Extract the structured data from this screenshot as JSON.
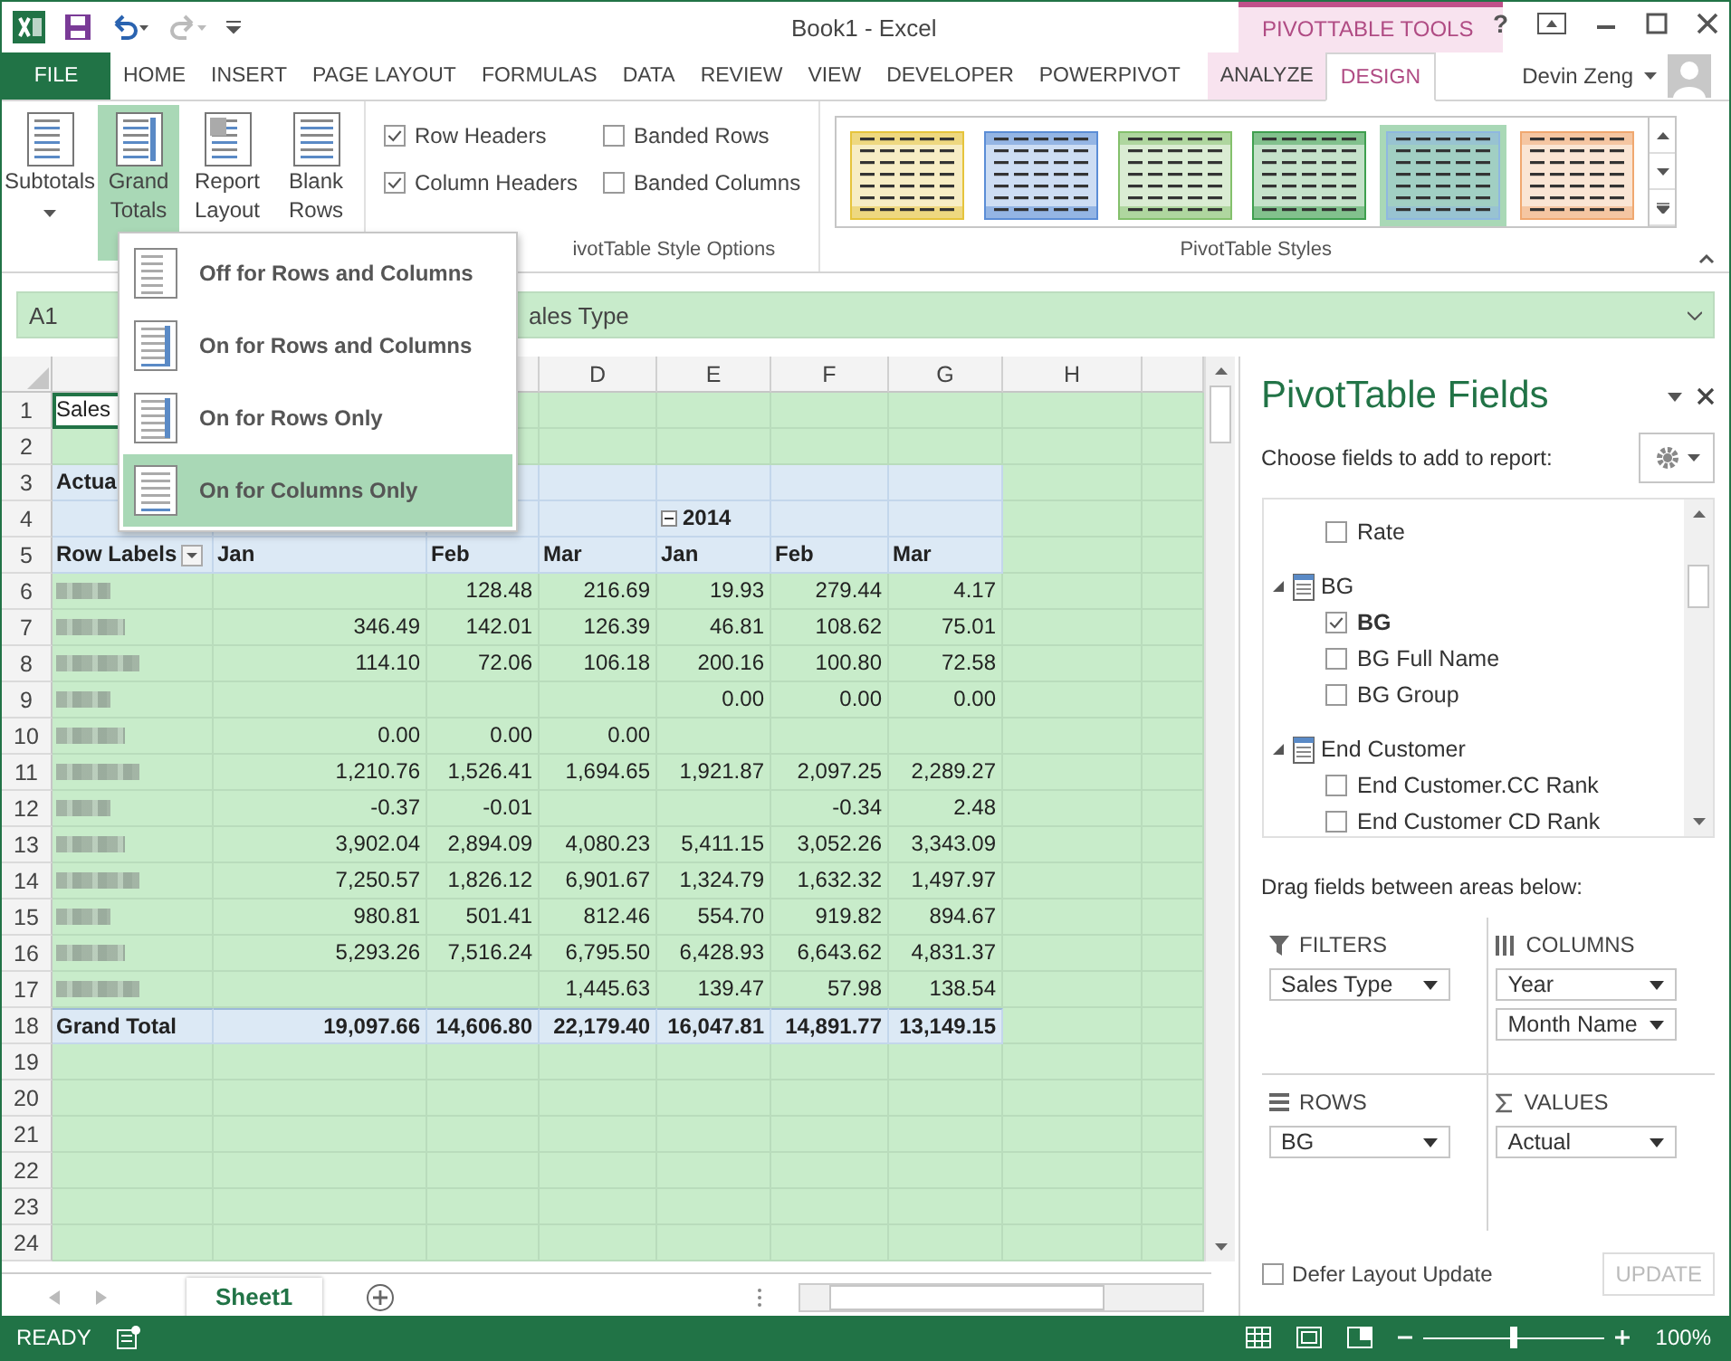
{
  "window": {
    "title": "Book1 - Excel",
    "context_tab": "PIVOTTABLE TOOLS",
    "help": "?"
  },
  "tabs": [
    {
      "label": "FILE",
      "kind": "file",
      "selected": false
    },
    {
      "label": "HOME",
      "kind": "tab",
      "selected": false
    },
    {
      "label": "INSERT",
      "kind": "tab",
      "selected": false
    },
    {
      "label": "PAGE LAYOUT",
      "kind": "tab",
      "selected": false
    },
    {
      "label": "FORMULAS",
      "kind": "tab",
      "selected": false
    },
    {
      "label": "DATA",
      "kind": "tab",
      "selected": false
    },
    {
      "label": "REVIEW",
      "kind": "tab",
      "selected": false
    },
    {
      "label": "VIEW",
      "kind": "tab",
      "selected": false
    },
    {
      "label": "DEVELOPER",
      "kind": "tab",
      "selected": false
    },
    {
      "label": "POWERPIVOT",
      "kind": "tab",
      "selected": false
    },
    {
      "label": "ANALYZE",
      "kind": "context",
      "selected": false
    },
    {
      "label": "DESIGN",
      "kind": "context",
      "selected": true
    }
  ],
  "user": {
    "name": "Devin Zeng"
  },
  "ribbon": {
    "layout_buttons": [
      {
        "lines": [
          "Subtotals"
        ],
        "selected": false
      },
      {
        "lines": [
          "Grand",
          "Totals"
        ],
        "selected": true
      },
      {
        "lines": [
          "Report",
          "Layout"
        ],
        "selected": false
      },
      {
        "lines": [
          "Blank",
          "Rows"
        ],
        "selected": false
      }
    ],
    "style_options": [
      {
        "label": "Row Headers",
        "checked": true
      },
      {
        "label": "Banded Rows",
        "checked": false
      },
      {
        "label": "Column Headers",
        "checked": true
      },
      {
        "label": "Banded Columns",
        "checked": false
      }
    ],
    "style_options_label": "ivotTable Style Options",
    "styles": [
      {
        "color": "#e6c43c",
        "selected": false
      },
      {
        "color": "#5b8dd6",
        "selected": false
      },
      {
        "color": "#84c06c",
        "selected": false
      },
      {
        "color": "#3f9f4f",
        "selected": false
      },
      {
        "color": "#8fb8e0",
        "selected": true
      },
      {
        "color": "#f0a870",
        "selected": false
      }
    ],
    "styles_label": "PivotTable Styles"
  },
  "grand_totals_menu": [
    {
      "label": "Off for Rows and Columns",
      "selected": false
    },
    {
      "label": "On for Rows and Columns",
      "selected": false
    },
    {
      "label": "On for Rows Only",
      "selected": false
    },
    {
      "label": "On for Columns Only",
      "selected": true
    }
  ],
  "formula_bar": {
    "name_box": "A1",
    "value": "ales Type"
  },
  "sheet": {
    "column_headers": [
      "D",
      "E",
      "F",
      "G",
      "H"
    ],
    "rows": [
      {
        "number": "1",
        "kind": "plain",
        "active_cell": true,
        "cells": [
          "Sales"
        ]
      },
      {
        "number": "2",
        "kind": "plain"
      },
      {
        "number": "3",
        "kind": "header",
        "cells": [
          "Actua"
        ]
      },
      {
        "number": "4",
        "kind": "header",
        "cells": [
          null,
          null,
          null,
          null,
          {
            "text": "2014",
            "expanded": true
          }
        ]
      },
      {
        "number": "5",
        "kind": "header",
        "cells": [
          {
            "text": "Row Labels",
            "filter": true
          },
          "Jan",
          "Feb",
          "Mar",
          "Jan",
          "Feb",
          "Mar"
        ]
      },
      {
        "number": "6",
        "kind": "data",
        "cells": [
          null,
          null,
          "128.48",
          "216.69",
          "19.93",
          "279.44",
          "4.17"
        ]
      },
      {
        "number": "7",
        "kind": "data",
        "cells": [
          null,
          "346.49",
          "142.01",
          "126.39",
          "46.81",
          "108.62",
          "75.01"
        ]
      },
      {
        "number": "8",
        "kind": "data",
        "cells": [
          null,
          "114.10",
          "72.06",
          "106.18",
          "200.16",
          "100.80",
          "72.58"
        ]
      },
      {
        "number": "9",
        "kind": "data",
        "cells": [
          null,
          null,
          null,
          null,
          "0.00",
          "0.00",
          "0.00"
        ]
      },
      {
        "number": "10",
        "kind": "data",
        "cells": [
          null,
          "0.00",
          "0.00",
          "0.00"
        ]
      },
      {
        "number": "11",
        "kind": "data",
        "cells": [
          null,
          "1,210.76",
          "1,526.41",
          "1,694.65",
          "1,921.87",
          "2,097.25",
          "2,289.27"
        ]
      },
      {
        "number": "12",
        "kind": "data",
        "cells": [
          null,
          "-0.37",
          "-0.01",
          null,
          null,
          "-0.34",
          "2.48"
        ]
      },
      {
        "number": "13",
        "kind": "data",
        "cells": [
          null,
          "3,902.04",
          "2,894.09",
          "4,080.23",
          "5,411.15",
          "3,052.26",
          "3,343.09"
        ]
      },
      {
        "number": "14",
        "kind": "data",
        "cells": [
          null,
          "7,250.57",
          "1,826.12",
          "6,901.67",
          "1,324.79",
          "1,632.32",
          "1,497.97"
        ]
      },
      {
        "number": "15",
        "kind": "data",
        "cells": [
          null,
          "980.81",
          "501.41",
          "812.46",
          "554.70",
          "919.82",
          "894.67"
        ]
      },
      {
        "number": "16",
        "kind": "data",
        "cells": [
          null,
          "5,293.26",
          "7,516.24",
          "6,795.50",
          "6,428.93",
          "6,643.62",
          "4,831.37"
        ]
      },
      {
        "number": "17",
        "kind": "data",
        "cells": [
          null,
          null,
          null,
          "1,445.63",
          "139.47",
          "57.98",
          "138.54"
        ]
      },
      {
        "number": "18",
        "kind": "total",
        "cells": [
          "Grand Total",
          "19,097.66",
          "14,606.80",
          "22,179.40",
          "16,047.81",
          "14,891.77",
          "13,149.15"
        ]
      },
      {
        "number": "19",
        "kind": "plain"
      },
      {
        "number": "20",
        "kind": "plain"
      },
      {
        "number": "21",
        "kind": "plain"
      },
      {
        "number": "22",
        "kind": "plain"
      },
      {
        "number": "23",
        "kind": "plain"
      },
      {
        "number": "24",
        "kind": "plain"
      }
    ],
    "sheet_tabs": [
      {
        "label": "Sheet1",
        "selected": true
      }
    ]
  },
  "field_pane": {
    "title": "PivotTable Fields",
    "prompt": "Choose fields to add to report:",
    "fields": [
      {
        "label": "Rate",
        "kind": "field",
        "checked": false
      },
      {
        "label": "BG",
        "kind": "table",
        "expanded": true,
        "children": [
          {
            "label": "BG",
            "kind": "field",
            "checked": true
          },
          {
            "label": "BG Full Name",
            "kind": "field",
            "checked": false
          },
          {
            "label": "BG Group",
            "kind": "field",
            "checked": false
          }
        ]
      },
      {
        "label": "End Customer",
        "kind": "table",
        "expanded": true,
        "children": [
          {
            "label": "End Customer.CC Rank",
            "kind": "field",
            "checked": false
          },
          {
            "label": "End Customer CD Rank",
            "kind": "field",
            "checked": false
          }
        ]
      }
    ],
    "drag_hint": "Drag fields between areas below:",
    "areas": [
      {
        "title": "FILTERS",
        "kind": "filters",
        "items": [
          "Sales Type"
        ]
      },
      {
        "title": "COLUMNS",
        "kind": "columns",
        "items": [
          "Year",
          "Month Name"
        ]
      },
      {
        "title": "ROWS",
        "kind": "rows",
        "items": [
          "BG"
        ]
      },
      {
        "title": "VALUES",
        "kind": "values",
        "items": [
          "Actual"
        ]
      }
    ],
    "defer": {
      "label": "Defer Layout Update",
      "checked": false
    },
    "update": {
      "label": "UPDATE",
      "disabled": true
    }
  },
  "status_bar": {
    "mode": "READY",
    "zoom": {
      "level": 0.5,
      "reading": "100%"
    }
  }
}
